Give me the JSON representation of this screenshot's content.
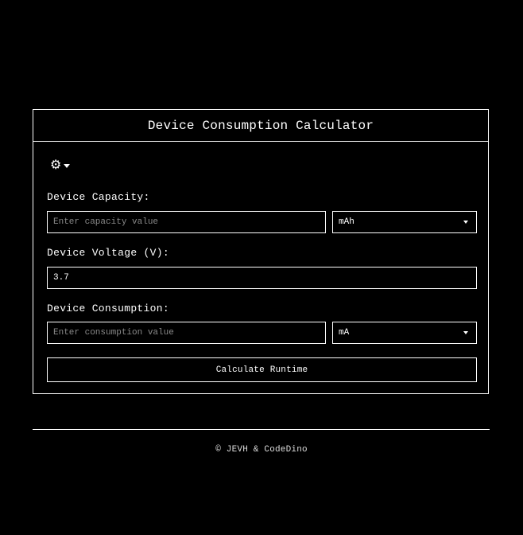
{
  "card": {
    "title": "Device Consumption Calculator",
    "settings_icon": "gear-icon",
    "capacity": {
      "label": "Device Capacity:",
      "placeholder": "Enter capacity value",
      "value": "",
      "unit": "mAh"
    },
    "voltage": {
      "label": "Device Voltage (V):",
      "value": "3.7"
    },
    "consumption": {
      "label": "Device Consumption:",
      "placeholder": "Enter consumption value",
      "value": "",
      "unit": "mA"
    },
    "calculate_label": "Calculate Runtime"
  },
  "footer": {
    "text": "© JEVH & CodeDino"
  },
  "colors": {
    "background": "#000000",
    "foreground": "#ffffff",
    "placeholder": "#8a8a8a"
  }
}
